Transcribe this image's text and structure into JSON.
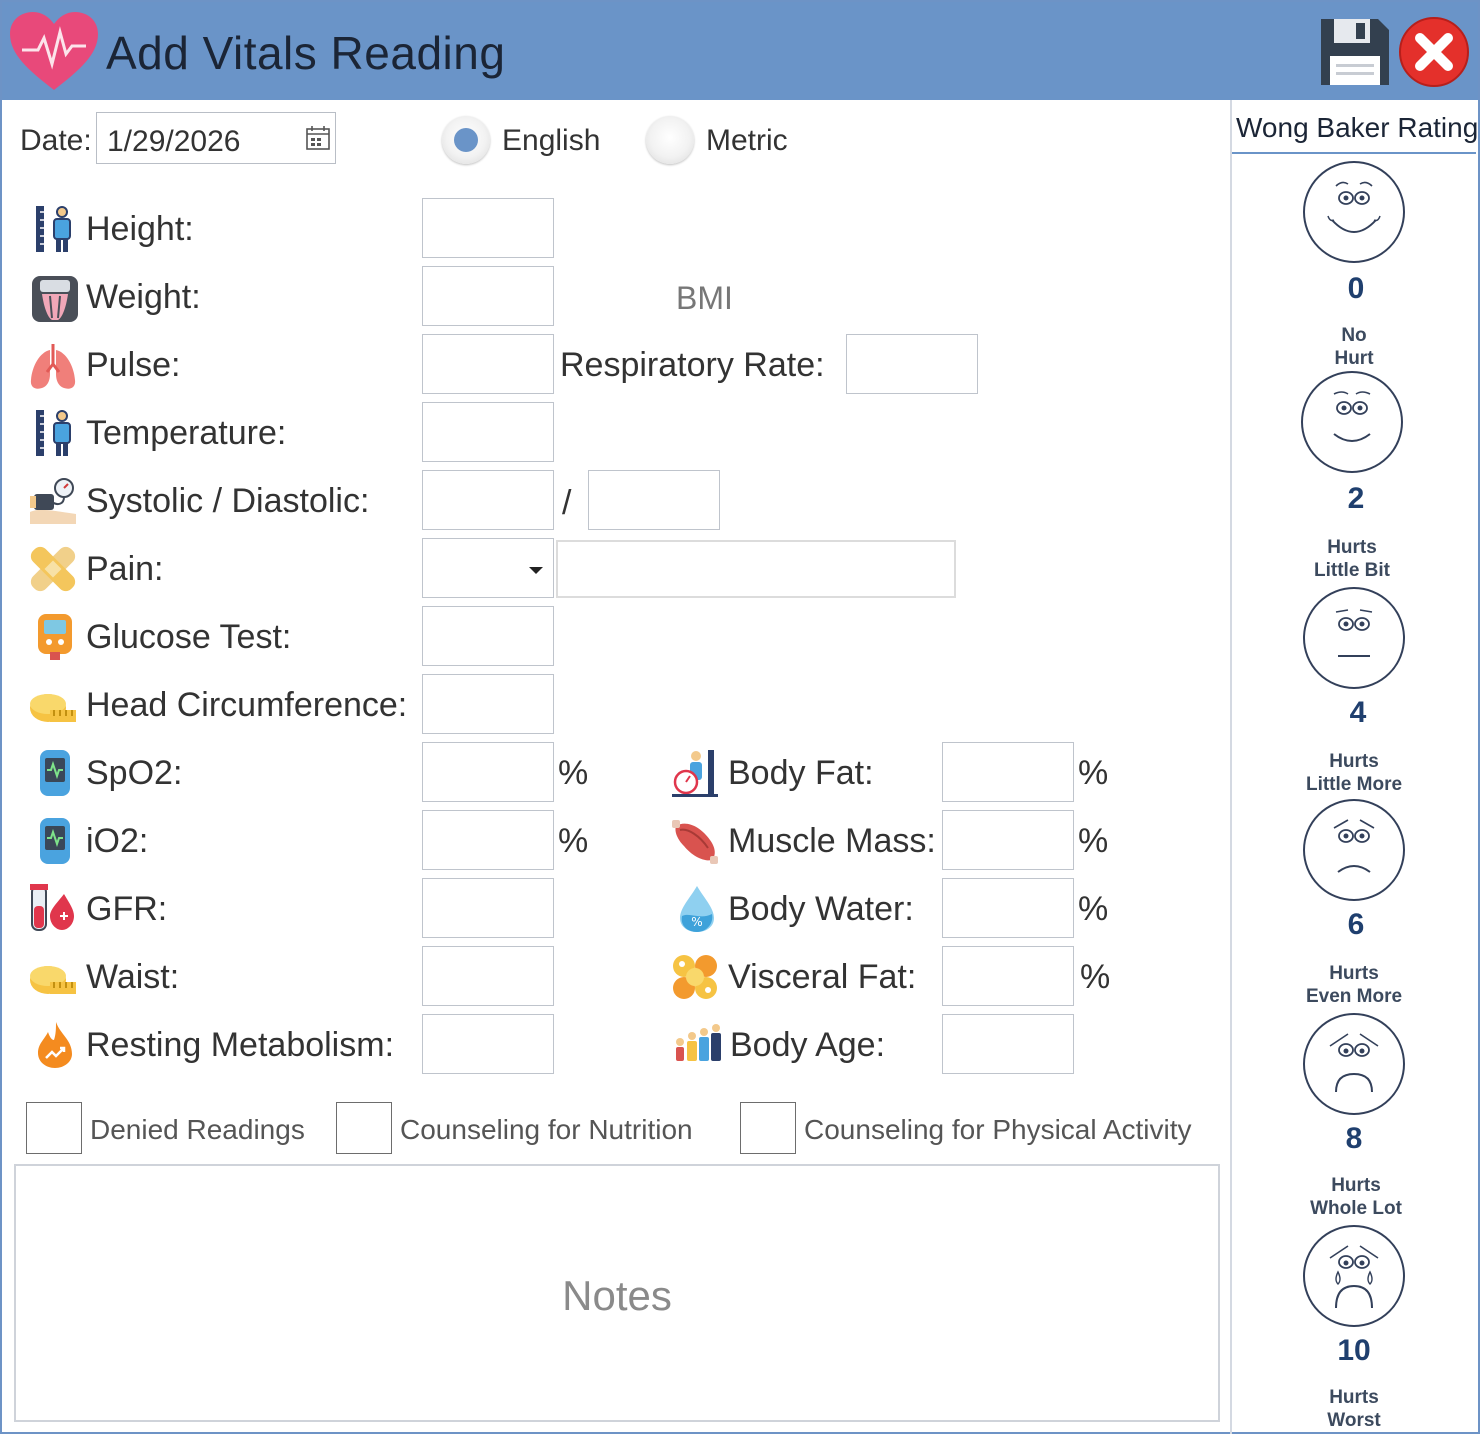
{
  "window": {
    "title": "Add Vitals Reading",
    "accent_color": "#6a94c8",
    "title_icon": "heart-pulse-icon",
    "save_icon": "floppy-disk-icon",
    "close_icon": "close-icon"
  },
  "date": {
    "label": "Date:",
    "value": "1/29/2026",
    "icon": "calendar-icon"
  },
  "units": {
    "options": [
      "English",
      "Metric"
    ],
    "selected": "English"
  },
  "vitals": {
    "height": "Height:",
    "weight": "Weight:",
    "bmi": "BMI",
    "pulse": "Pulse:",
    "respiratory_rate": "Respiratory Rate:",
    "temperature": "Temperature:",
    "systolic_diastolic": "Systolic / Diastolic:",
    "bp_separator": "/",
    "pain": "Pain:",
    "glucose_test": "Glucose Test:",
    "head_circumference": "Head Circumference:",
    "spo2": "SpO2:",
    "io2": "iO2:",
    "gfr": "GFR:",
    "waist": "Waist:",
    "resting_metabolism": "Resting Metabolism:",
    "body_fat": "Body Fat:",
    "muscle_mass": "Muscle Mass:",
    "body_water": "Body Water:",
    "visceral_fat": "Visceral Fat:",
    "body_age": "Body Age:",
    "percent": "%"
  },
  "checkboxes": {
    "denied": "Denied Readings",
    "nutrition": "Counseling for Nutrition",
    "physical": "Counseling for Physical Activity"
  },
  "notes": {
    "placeholder": "Notes"
  },
  "wong_baker": {
    "title": "Wong Baker Rating",
    "faces": [
      {
        "score": "0",
        "line1": "No",
        "line2": "Hurt"
      },
      {
        "score": "2",
        "line1": "Hurts",
        "line2": "Little Bit"
      },
      {
        "score": "4",
        "line1": "Hurts",
        "line2": "Little More"
      },
      {
        "score": "6",
        "line1": "Hurts",
        "line2": "Even More"
      },
      {
        "score": "8",
        "line1": "Hurts",
        "line2": "Whole Lot"
      },
      {
        "score": "10",
        "line1": "Hurts",
        "line2": "Worst"
      }
    ]
  }
}
